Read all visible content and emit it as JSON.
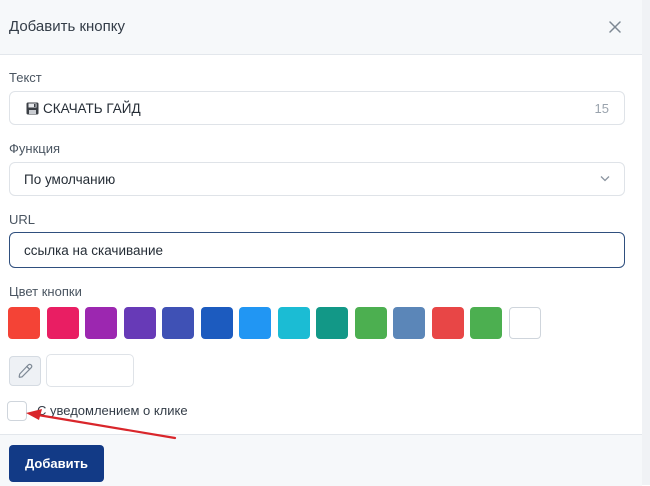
{
  "dialog": {
    "title": "Добавить кнопку",
    "close_icon": "close-icon"
  },
  "text_field": {
    "label": "Текст",
    "icon": "floppy-disk-icon",
    "value": "СКАЧАТЬ ГАЙД",
    "counter": "15"
  },
  "function_field": {
    "label": "Функция",
    "value": "По умолчанию",
    "icon": "chevron-down-icon"
  },
  "url_field": {
    "label": "URL",
    "value": "ссылка на скачивание"
  },
  "button_color": {
    "label": "Цвет кнопки",
    "swatches": [
      "#f44336",
      "#e91e63",
      "#9c27b0",
      "#673ab7",
      "#3f51b5",
      "#1c5bbf",
      "#2196f3",
      "#1bbcd4",
      "#129887",
      "#4caf50",
      "#5b86b8",
      "#e84646",
      "#4caf50",
      "#ffffff"
    ],
    "picker_icon": "eyedropper-icon",
    "custom_value": ""
  },
  "notify": {
    "label": "С уведомлением о клике",
    "checked": false
  },
  "footer": {
    "add_label": "Добавить"
  },
  "annotation": {
    "arrow_color": "#d9262b"
  }
}
